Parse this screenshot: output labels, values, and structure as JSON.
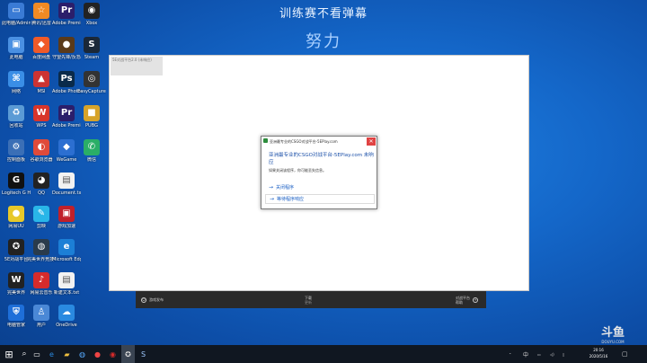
{
  "stream": {
    "title": "训练赛不看弹幕",
    "subtitle": "努力"
  },
  "desktop_icons": [
    {
      "name": "recycle-bin-icon",
      "label": "此电脑/Admin",
      "color": "#3a7bd5",
      "glyph": "▭"
    },
    {
      "name": "tencent-icon",
      "label": "腾讯/迅雷",
      "color": "#f08a24",
      "glyph": "☆"
    },
    {
      "name": "premiere-icon",
      "label": "Adobe Premiere Pro",
      "color": "#2b1e6b",
      "glyph": "Pr"
    },
    {
      "name": "obs-icon",
      "label": "Xbox",
      "color": "#222",
      "glyph": "◉"
    },
    {
      "name": "computer-icon",
      "label": "此电脑",
      "color": "#4a90e2",
      "glyph": "▣"
    },
    {
      "name": "app-icon",
      "label": "百度网盘",
      "color": "#f05a28",
      "glyph": "◆"
    },
    {
      "name": "game-icon",
      "label": "守望先锋/反恐",
      "color": "#5a3a1a",
      "glyph": "●"
    },
    {
      "name": "steam-icon",
      "label": "Steam",
      "color": "#1b2838",
      "glyph": "S"
    },
    {
      "name": "network-icon",
      "label": "网络",
      "color": "#3a8ee6",
      "glyph": "⌘"
    },
    {
      "name": "monster-icon",
      "label": "MSI",
      "color": "#c33",
      "glyph": "▲"
    },
    {
      "name": "photoshop-icon",
      "label": "Adobe Photoshop",
      "color": "#0a2a4a",
      "glyph": "Ps"
    },
    {
      "name": "record-icon",
      "label": "EasyCapture",
      "color": "#333",
      "glyph": "◎"
    },
    {
      "name": "recycle-icon",
      "label": "回收站",
      "color": "#5b9bd5",
      "glyph": "♻"
    },
    {
      "name": "wps-icon",
      "label": "WPS",
      "color": "#d8352a",
      "glyph": "W"
    },
    {
      "name": "premiere2-icon",
      "label": "Adobe Premiere",
      "color": "#2b1e6b",
      "glyph": "Pr"
    },
    {
      "name": "pubg-icon",
      "label": "PUBG",
      "color": "#d6a32a",
      "glyph": "■"
    },
    {
      "name": "control-icon",
      "label": "控制面板",
      "color": "#3b6fb6",
      "glyph": "⚙"
    },
    {
      "name": "chrome-icon",
      "label": "谷歌浏览器",
      "color": "#e04a3a",
      "glyph": "◐"
    },
    {
      "name": "wegame-icon",
      "label": "WeGame",
      "color": "#2c6fd1",
      "glyph": "◆"
    },
    {
      "name": "wechat-icon",
      "label": "微信",
      "color": "#2aae67",
      "glyph": "✆"
    },
    {
      "name": "logitech-icon",
      "label": "Logitech G HUB",
      "color": "#111",
      "glyph": "G"
    },
    {
      "name": "qq-icon",
      "label": "QQ",
      "color": "#222",
      "glyph": "◕"
    },
    {
      "name": "doc-icon",
      "label": "Document.txt",
      "color": "#f2f2f2",
      "glyph": "▤"
    },
    {
      "name": "dt-blank-1",
      "label": "",
      "color": "transparent",
      "glyph": ""
    },
    {
      "name": "netease-icon",
      "label": "网易UU",
      "color": "#e7c82a",
      "glyph": "●"
    },
    {
      "name": "edit-icon",
      "label": "剪映",
      "color": "#29b6e8",
      "glyph": "✎"
    },
    {
      "name": "red-app-icon",
      "label": "游戏加速",
      "color": "#c0202a",
      "glyph": "▣"
    },
    {
      "name": "dt-blank-2",
      "label": "",
      "color": "transparent",
      "glyph": ""
    },
    {
      "name": "csgo-icon",
      "label": "5E对战平台",
      "color": "#222",
      "glyph": "✪"
    },
    {
      "name": "steam2-icon",
      "label": "完美世界竞技平台",
      "color": "#2a3b4c",
      "glyph": "◍"
    },
    {
      "name": "edge-icon",
      "label": "Microsoft Edge",
      "color": "#1c7fd6",
      "glyph": "e"
    },
    {
      "name": "dt-blank-3",
      "label": "",
      "color": "transparent",
      "glyph": ""
    },
    {
      "name": "perfect-icon",
      "label": "完美世界",
      "color": "#222",
      "glyph": "W"
    },
    {
      "name": "netease-music-icon",
      "label": "网易云音乐",
      "color": "#d62b2b",
      "glyph": "♪"
    },
    {
      "name": "doc2-icon",
      "label": "新建文本.txt",
      "color": "#f2f2f2",
      "glyph": "▤"
    },
    {
      "name": "dt-blank-4",
      "label": "",
      "color": "transparent",
      "glyph": ""
    },
    {
      "name": "security-icon",
      "label": "电脑管家",
      "color": "#1e6fd9",
      "glyph": "⛨"
    },
    {
      "name": "user-icon",
      "label": "用户",
      "color": "#4a88d6",
      "glyph": "♙"
    },
    {
      "name": "onedrive-icon",
      "label": "OneDrive",
      "color": "#2a8ae0",
      "glyph": "☁"
    }
  ],
  "app_window": {
    "caption": "5E对战平台2.0 (未响应)"
  },
  "game_bar": {
    "left": "游戏发布",
    "center_1": "下载",
    "center_2": "更新",
    "right_1": "对战平台",
    "right_2": "帮助"
  },
  "dialog": {
    "title": "亚洲最专业的CSGO对战平台-5EPlay.com",
    "close": "✕",
    "heading": "亚洲最专业的CSGO对战平台-5EPlay.com 未响应",
    "body": "如果关闭该程序，你可能丢失信息。",
    "option_close": "关闭程序",
    "option_wait": "等待程序响应",
    "arrow": "→"
  },
  "watermark": {
    "logo": "斗鱼",
    "site": "DOUYU.COM"
  },
  "taskbar": {
    "start": "⊞",
    "search": "⌕",
    "task_view": "▭",
    "pinned": [
      {
        "name": "edge-task-icon",
        "glyph": "e",
        "color": "#2a8ae0"
      },
      {
        "name": "explorer-task-icon",
        "glyph": "▰",
        "color": "#f0c040"
      },
      {
        "name": "store-task-icon",
        "glyph": "◍",
        "color": "#55aaff"
      },
      {
        "name": "app-task-icon",
        "glyph": "●",
        "color": "#e44"
      },
      {
        "name": "netease-task-icon",
        "glyph": "◉",
        "color": "#d62b2b"
      },
      {
        "name": "csgo-task-icon",
        "glyph": "✪",
        "color": "#ddd"
      },
      {
        "name": "steam-task-icon",
        "glyph": "S",
        "color": "#9ec8ff"
      }
    ],
    "ime": "中",
    "time": "20:16",
    "date": "2020/5/16",
    "notify": "▢"
  }
}
